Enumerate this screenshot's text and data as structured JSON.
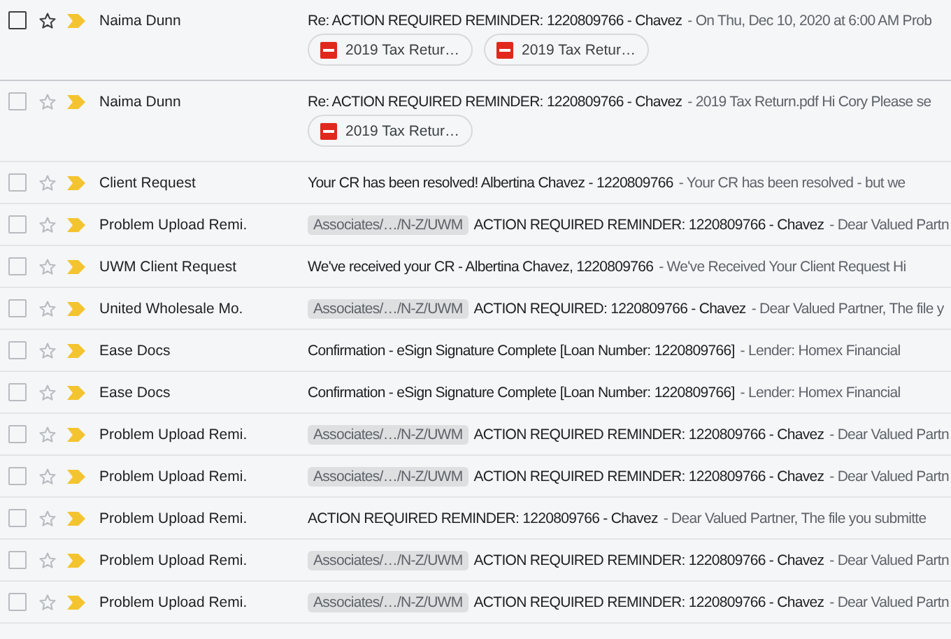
{
  "messages": [
    {
      "sender": "Naima Dunn",
      "checked": false,
      "hovered": true,
      "subject": "Re: ACTION REQUIRED REMINDER: 1220809766 - Chavez",
      "snippet": "- On Thu, Dec 10, 2020 at 6:00 AM Prob",
      "attachments": [
        "2019 Tax Retur…",
        "2019 Tax Retur…"
      ]
    },
    {
      "sender": "Naima Dunn",
      "checked": false,
      "hovered": false,
      "subject": "Re: ACTION REQUIRED REMINDER: 1220809766 - Chavez",
      "snippet": "- 2019 Tax Return.pdf Hi Cory Please se",
      "attachments": [
        "2019 Tax Retur…"
      ]
    },
    {
      "sender": "Client Request",
      "checked": false,
      "hovered": false,
      "subject": "Your CR has been resolved! Albertina Chavez - 1220809766",
      "snippet": "- Your CR has been resolved - but we"
    },
    {
      "sender": "Problem Upload Remi.",
      "checked": false,
      "hovered": false,
      "label": "Associates/…/N-Z/UWM",
      "subject": "ACTION REQUIRED REMINDER: 1220809766 - Chavez",
      "snippet": "- Dear Valued Partn"
    },
    {
      "sender": "UWM Client Request",
      "checked": false,
      "hovered": false,
      "subject": "We've received your CR - Albertina Chavez, 1220809766",
      "snippet": "- We've Received Your Client Request Hi"
    },
    {
      "sender": "United Wholesale Mo.",
      "checked": false,
      "hovered": false,
      "label": "Associates/…/N-Z/UWM",
      "subject": "ACTION REQUIRED: 1220809766 - Chavez",
      "snippet": "- Dear Valued Partner, The file y"
    },
    {
      "sender": "Ease Docs",
      "checked": false,
      "hovered": false,
      "subject": "Confirmation - eSign Signature Complete [Loan Number: 1220809766]",
      "snippet": "- Lender: Homex Financial"
    },
    {
      "sender": "Ease Docs",
      "checked": false,
      "hovered": false,
      "subject": "Confirmation - eSign Signature Complete [Loan Number: 1220809766]",
      "snippet": "- Lender: Homex Financial"
    },
    {
      "sender": "Problem Upload Remi.",
      "checked": false,
      "hovered": false,
      "label": "Associates/…/N-Z/UWM",
      "subject": "ACTION REQUIRED REMINDER: 1220809766 - Chavez",
      "snippet": "- Dear Valued Partn"
    },
    {
      "sender": "Problem Upload Remi.",
      "checked": false,
      "hovered": false,
      "label": "Associates/…/N-Z/UWM",
      "subject": "ACTION REQUIRED REMINDER: 1220809766 - Chavez",
      "snippet": "- Dear Valued Partn"
    },
    {
      "sender": "Problem Upload Remi.",
      "checked": false,
      "hovered": false,
      "subject": "ACTION REQUIRED REMINDER: 1220809766 - Chavez",
      "snippet": "- Dear Valued Partner, The file you submitte"
    },
    {
      "sender": "Problem Upload Remi.",
      "checked": false,
      "hovered": false,
      "label": "Associates/…/N-Z/UWM",
      "subject": "ACTION REQUIRED REMINDER: 1220809766 - Chavez",
      "snippet": "- Dear Valued Partn"
    },
    {
      "sender": "Problem Upload Remi.",
      "checked": false,
      "hovered": false,
      "label": "Associates/…/N-Z/UWM",
      "subject": "ACTION REQUIRED REMINDER: 1220809766 - Chavez",
      "snippet": "- Dear Valued Partn"
    }
  ]
}
